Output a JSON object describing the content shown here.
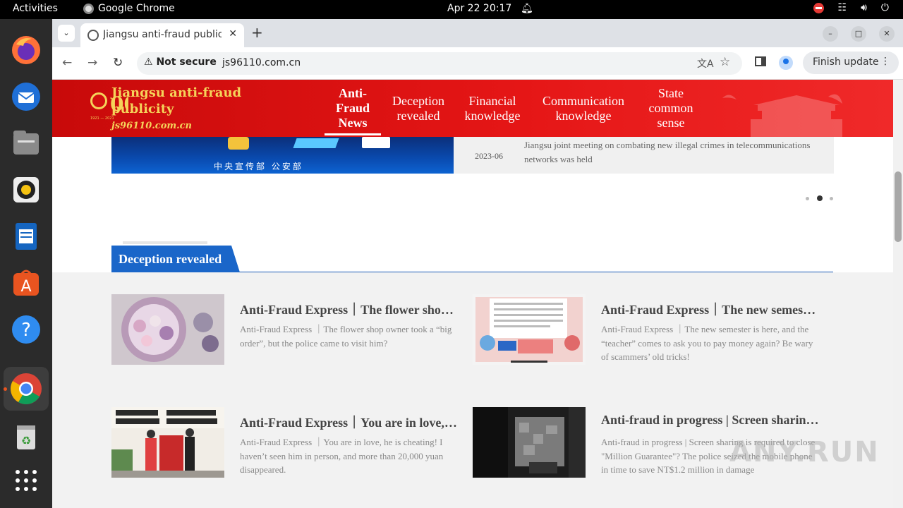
{
  "system": {
    "activities": "Activities",
    "app_name": "Google Chrome",
    "clock": "Apr 22  20:17"
  },
  "browser": {
    "tab_title": "Jiangsu anti-fraud publicity",
    "security_label": "Not secure",
    "url": "js96110.com.cn",
    "finish_update": "Finish update"
  },
  "site": {
    "logo_title": "Jiangsu anti-fraud publicity",
    "logo_url": "js96110.com.cn",
    "nav": [
      {
        "label": "Anti-Fraud News",
        "active": true
      },
      {
        "label": "Deception revealed",
        "active": false
      },
      {
        "label": "Financial knowledge",
        "active": false
      },
      {
        "label": "Communication knowledge",
        "active": false
      },
      {
        "label": "State common sense",
        "active": false
      }
    ]
  },
  "carousel": {
    "caption": "中央宣传部  公安部",
    "news_date": "2023-06",
    "news_text": "Jiangsu joint meeting on combating new illegal crimes in telecommunications networks was held",
    "active_index": 1,
    "dot_count": 3
  },
  "section": {
    "title": "Deception revealed",
    "articles": [
      {
        "title": "Anti-Fraud Express｜The flower shop owner took a \"big order\", but the police came to visit him?",
        "desc": "Anti-Fraud Express ｜The flower shop owner took a “big order”, but the police came to visit him?",
        "thumb": "flower-bouquet"
      },
      {
        "title": "Anti-Fraud Express｜The new semester is here, and the \"teacher\" comes to ask you to pay money again?",
        "desc": "Anti-Fraud Express ｜The new semester is here, and the “teacher” comes to ask you to pay money again? Be wary of scammers’ old tricks!",
        "thumb": "phone-screenshot"
      },
      {
        "title": "Anti-Fraud Express｜You are in love, he is cheating!",
        "desc": "Anti-Fraud Express ｜You are in love, he is cheating! I haven’t seen him in person, and more than 20,000 yuan disappeared.",
        "thumb": "banner-presentation"
      },
      {
        "title": "Anti-fraud in progress | Screen sharing is required to close \"Million Guarantee\"",
        "desc": "Anti-fraud in progress | Screen sharing is required to close \"Million Guarantee\"? The police seized the mobile phone in time to save NT$1.2 million in damage",
        "thumb": "police-phone"
      }
    ]
  },
  "watermark": "ANY.RUN",
  "colors": {
    "header_red": "#e51616",
    "logo_gold": "#f5d35a",
    "section_blue": "#1a66c9"
  }
}
